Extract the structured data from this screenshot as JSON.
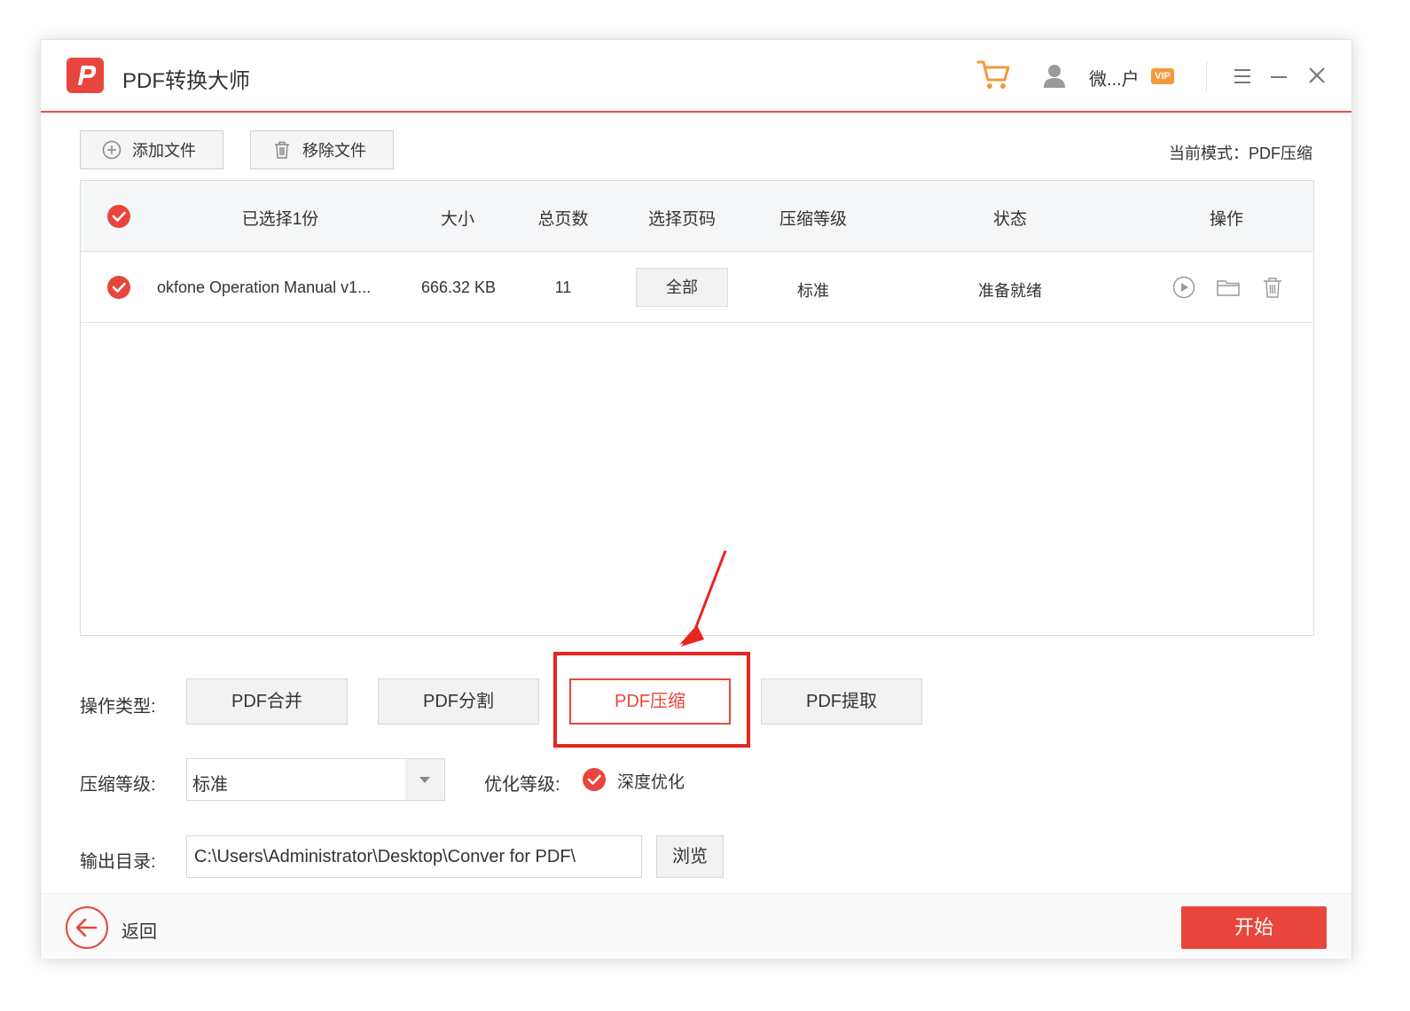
{
  "app": {
    "title": "PDF转换大师",
    "username": "微...户",
    "vip_badge": "VIP"
  },
  "toolbar": {
    "add_label": "添加文件",
    "remove_label": "移除文件",
    "mode_label": "当前模式：PDF压缩"
  },
  "table": {
    "headers": [
      "已选择1份",
      "大小",
      "总页数",
      "选择页码",
      "压缩等级",
      "状态",
      "操作"
    ],
    "rows": [
      {
        "name": "okfone Operation Manual v1...",
        "size": "666.32 KB",
        "pages": "11",
        "page_select": "全部",
        "level": "标准",
        "status": "准备就绪"
      }
    ]
  },
  "operation": {
    "label": "操作类型:",
    "buttons": [
      "PDF合并",
      "PDF分割",
      "PDF压缩",
      "PDF提取"
    ],
    "active": "PDF压缩"
  },
  "compress": {
    "label": "压缩等级:",
    "value": "标准"
  },
  "optimize": {
    "label": "优化等级:",
    "option": "深度优化"
  },
  "output": {
    "label": "输出目录:",
    "path": "C:\\Users\\Administrator\\Desktop\\Conver for PDF\\",
    "browse": "浏览"
  },
  "footer": {
    "back": "返回",
    "start": "开始"
  },
  "colors": {
    "accent": "#e8453c",
    "highlight": "#e8251e"
  }
}
